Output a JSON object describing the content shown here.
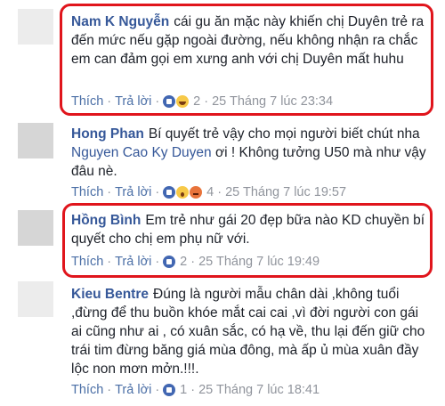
{
  "comments": [
    {
      "author": "Nam K Nguyễn",
      "text": "cái gu ăn mặc này khiến chị Duyên trẻ ra đến mức nếu gặp ngoài đường, nếu không nhận ra chắc em can đảm gọi em xưng anh với chị Duyên mất huhu",
      "like_label": "Thích",
      "reply_label": "Trả lời",
      "reaction_count": "2",
      "timestamp": "25 Tháng 7 lúc 23:34",
      "reactions": [
        "like-icon",
        "haha-icon"
      ]
    },
    {
      "author": "Hong Phan",
      "text_before": "Bí quyết trẻ vậy cho mọi người biết chút nha ",
      "mention": "Nguyen Cao Ky Duyen",
      "text_after": " ơi ! Không tưởng U50 mà như vậy đâu nè.",
      "like_label": "Thích",
      "reply_label": "Trả lời",
      "reaction_count": "4",
      "timestamp": "25 Tháng 7 lúc 19:57",
      "reactions": [
        "like-icon",
        "wow-icon",
        "angry-icon"
      ]
    },
    {
      "author": "Hồng Bình",
      "text": "Em trẻ như gái 20 đẹp bữa nào KD chuyền bí quyết cho chị em phụ nữ với.",
      "like_label": "Thích",
      "reply_label": "Trả lời",
      "reaction_count": "2",
      "timestamp": "25 Tháng 7 lúc 19:49",
      "reactions": [
        "like-icon"
      ]
    },
    {
      "author": "Kieu Bentre",
      "text": "Đúng là người mẫu chân dài ,không tuổi ,đừng để thu buồn khóe mắt cai cai ,vì đời người con gái ai cũng như ai , có xuân sắc, có hạ về, thu lại đến giữ cho trái tim đừng băng giá mùa đông, mà ấp ủ mùa xuân đầy lộc non mơn mởn.!!!.",
      "like_label": "Thích",
      "reply_label": "Trả lời",
      "reaction_count": "1",
      "timestamp": "25 Tháng 7 lúc 18:41",
      "reactions": [
        "like-icon"
      ]
    }
  ],
  "colors": {
    "link": "#365899",
    "text": "#1d2129",
    "meta": "#90949c",
    "highlight": "#e0151c"
  }
}
